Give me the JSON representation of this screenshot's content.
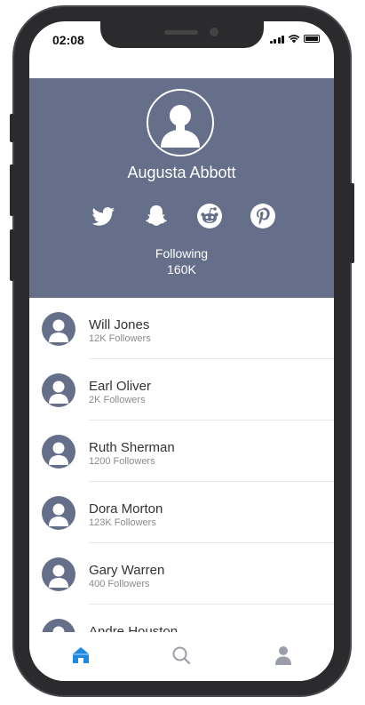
{
  "status_bar": {
    "time": "02:08"
  },
  "profile": {
    "name": "Augusta Abbott",
    "following_label": "Following",
    "following_count": "160K",
    "socials": [
      "twitter-icon",
      "snapchat-icon",
      "reddit-icon",
      "pinterest-icon"
    ]
  },
  "list": [
    {
      "name": "Will Jones",
      "followers": "12K Followers"
    },
    {
      "name": "Earl Oliver",
      "followers": "2K Followers"
    },
    {
      "name": "Ruth Sherman",
      "followers": "1200 Followers"
    },
    {
      "name": "Dora Morton",
      "followers": "123K Followers"
    },
    {
      "name": "Gary Warren",
      "followers": "400 Followers"
    },
    {
      "name": "Andre Houston",
      "followers": ""
    }
  ],
  "tabbar": {
    "items": [
      "home-icon",
      "search-icon",
      "user-icon"
    ],
    "active": "home-icon"
  },
  "colors": {
    "header_bg": "#666f8a",
    "accent": "#1e88e5",
    "inactive_icon": "#9a9ea8"
  }
}
